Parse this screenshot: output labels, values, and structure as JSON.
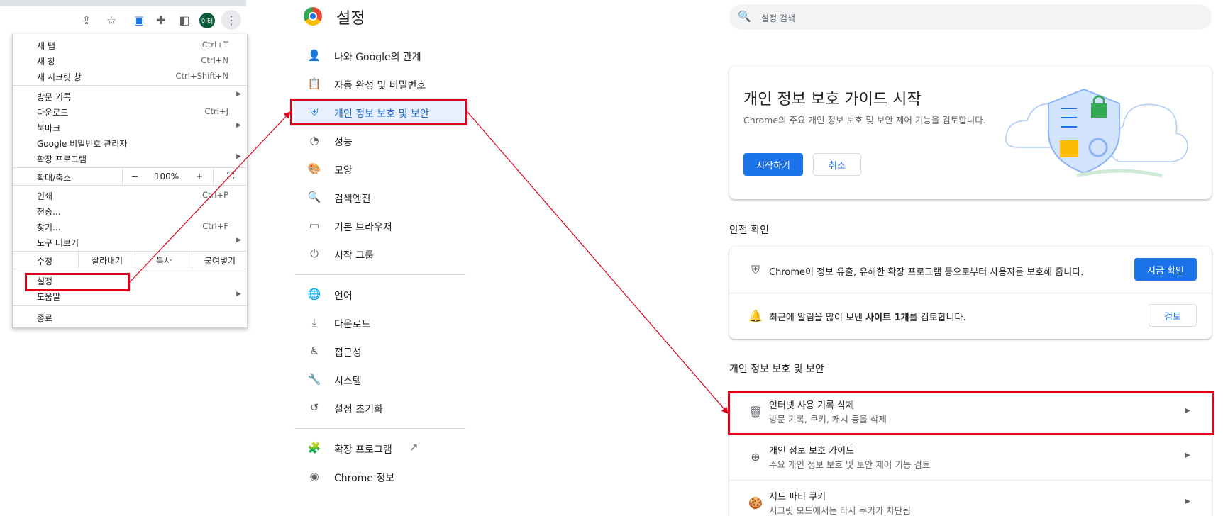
{
  "menu": {
    "items": [
      {
        "label": "새 탭",
        "shortcut": "Ctrl+T"
      },
      {
        "label": "새 창",
        "shortcut": "Ctrl+N"
      },
      {
        "label": "새 시크릿 창",
        "shortcut": "Ctrl+Shift+N"
      },
      {
        "label": "방문 기록",
        "shortcut": ""
      },
      {
        "label": "다운로드",
        "shortcut": "Ctrl+J"
      },
      {
        "label": "북마크",
        "shortcut": ""
      },
      {
        "label": "Google 비밀번호 관리자",
        "shortcut": ""
      },
      {
        "label": "확장 프로그램",
        "shortcut": ""
      },
      {
        "label": "인쇄",
        "shortcut": "Ctrl+P"
      },
      {
        "label": "전송...",
        "shortcut": ""
      },
      {
        "label": "찾기...",
        "shortcut": "Ctrl+F"
      },
      {
        "label": "도구 더보기",
        "shortcut": ""
      },
      {
        "label": "설정",
        "shortcut": ""
      },
      {
        "label": "도움말",
        "shortcut": ""
      },
      {
        "label": "종료",
        "shortcut": ""
      }
    ],
    "zoom": {
      "label": "확대/축소",
      "minus": "－",
      "value": "100%",
      "plus": "+"
    },
    "edit": {
      "label": "수정",
      "cut": "잘라내기",
      "copy": "복사",
      "paste": "붙여넣기"
    },
    "avatar_text": "이터"
  },
  "nav": {
    "title": "설정",
    "items": [
      {
        "label": "나와 Google의 관계",
        "icon": "person-icon"
      },
      {
        "label": "자동 완성 및 비밀번호",
        "icon": "clipboard-icon"
      },
      {
        "label": "개인 정보 보호 및 보안",
        "icon": "shield-icon"
      },
      {
        "label": "성능",
        "icon": "speedometer-icon"
      },
      {
        "label": "모양",
        "icon": "palette-icon"
      },
      {
        "label": "검색엔진",
        "icon": "search-icon"
      },
      {
        "label": "기본 브라우저",
        "icon": "browser-icon"
      },
      {
        "label": "시작 그룹",
        "icon": "power-icon"
      },
      {
        "label": "언어",
        "icon": "globe-icon"
      },
      {
        "label": "다운로드",
        "icon": "download-icon"
      },
      {
        "label": "접근성",
        "icon": "accessibility-icon"
      },
      {
        "label": "시스템",
        "icon": "wrench-icon"
      },
      {
        "label": "설정 초기화",
        "icon": "restore-icon"
      },
      {
        "label": "확장 프로그램",
        "icon": "puzzle-icon"
      },
      {
        "label": "Chrome 정보",
        "icon": "chrome-icon"
      }
    ]
  },
  "content": {
    "search_placeholder": "설정 검색",
    "guide": {
      "title": "개인 정보 보호 가이드 시작",
      "desc": "Chrome의 주요 개인 정보 보호 및 보안 제어 기능을 검토합니다.",
      "start": "시작하기",
      "cancel": "취소"
    },
    "safety": {
      "heading": "안전 확인",
      "row1": "Chrome이 정보 유출, 유해한 확장 프로그램 등으로부터 사용자를 보호해 줍니다.",
      "row1_btn": "지금 확인",
      "row2_pre": "최근에 알림을 많이 보낸 ",
      "row2_bold": "사이트 1개",
      "row2_post": "를 검토합니다.",
      "row2_btn": "검토"
    },
    "privacy": {
      "heading": "개인 정보 보호 및 보안",
      "rows": [
        {
          "title": "인터넷 사용 기록 삭제",
          "sub": "방문 기록, 쿠키, 캐시 등을 삭제"
        },
        {
          "title": "개인 정보 보호 가이드",
          "sub": "주요 개인 정보 보호 및 보안 제어 기능 검토"
        },
        {
          "title": "서드 파티 쿠키",
          "sub": "시크릿 모드에서는 타사 쿠키가 차단됨"
        }
      ]
    }
  },
  "colors": {
    "highlight": "#e0001b",
    "accent": "#1a73e8"
  }
}
